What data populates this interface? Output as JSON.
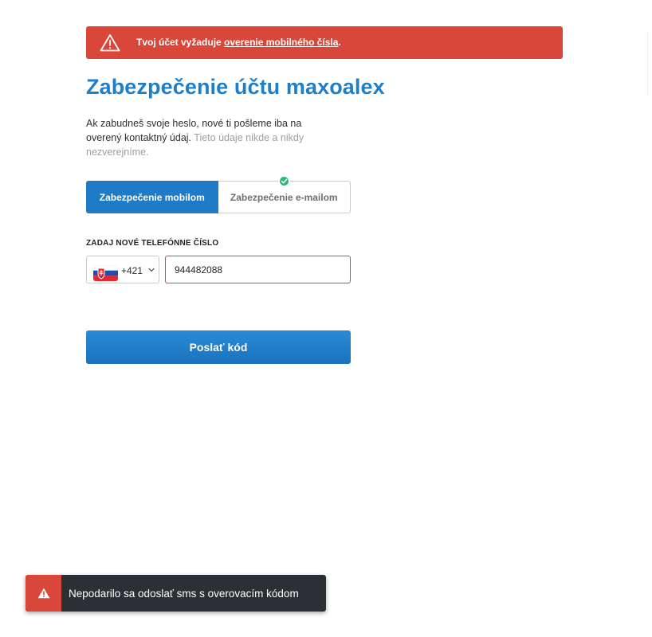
{
  "alert": {
    "text_prefix": "Tvoj účet vyžaduje ",
    "link_text": "overenie mobilného čísla",
    "text_suffix": ".",
    "icon": "warning-triangle-icon",
    "color": "#d9473a"
  },
  "title": "Zabezpečenie účtu maxoalex",
  "description": {
    "main": "Ak zabudneš svoje heslo, nové ti pošleme iba na overený kontaktný údaj.",
    "muted": "Tieto údaje nikde a nikdy nezverejníme."
  },
  "tabs": [
    {
      "label": "Zabezpečenie mobilom",
      "active": true
    },
    {
      "label": "Zabezpečenie e-mailom",
      "active": false,
      "verified": true
    }
  ],
  "phone": {
    "label": "ZADAJ NOVÉ TELEFÓNNE ČÍSLO",
    "country_flag": "slovakia-flag",
    "country_code": "+421",
    "number": "944482088"
  },
  "send_button": "Poslať kód",
  "toast": {
    "message": "Nepodarilo sa odoslať sms s overovacím kódom",
    "icon": "warning-triangle-icon"
  },
  "colors": {
    "accent": "#1e7fc9",
    "error": "#d9473a",
    "success": "#2bb873"
  }
}
